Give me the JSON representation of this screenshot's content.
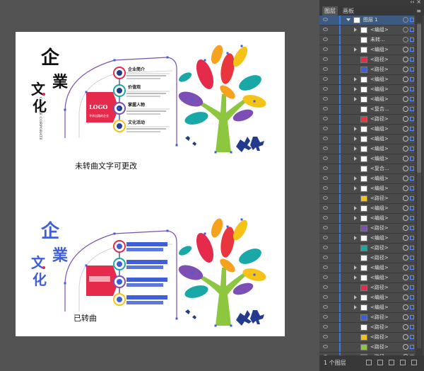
{
  "artboard": {
    "caption_top": "未转曲文字可更改",
    "caption_bottom": "已转曲",
    "title_chars": [
      "企",
      "業",
      "文",
      "化"
    ],
    "subtitle": "CULTURE CORPORATE",
    "logo_text": "LOGO",
    "logo_sub": "寻求出路的企业",
    "items": [
      "企业简介",
      "价值观",
      "掌握人物",
      "文化活动"
    ],
    "colors": {
      "accent": "#e52a4c",
      "blue": "#3f5fd8",
      "teal": "#18a8a8",
      "purple": "#7b4fb3",
      "yellow": "#f5c318",
      "green": "#8dc63f",
      "orange": "#f6a21e",
      "red": "#e8353e",
      "navy": "#243a8c"
    }
  },
  "panel": {
    "title_strip": "‹‹  ×",
    "tabs": [
      "图层",
      "画板"
    ],
    "menu_icon": "≡",
    "rows": [
      {
        "label": "图层 1",
        "level": "top",
        "arrow": true,
        "target": "ring"
      },
      {
        "label": "<编组>",
        "arrow": true,
        "target": "ring"
      },
      {
        "label": "未转...",
        "arrow": false,
        "target": "ring"
      },
      {
        "label": "<编组>",
        "arrow": true,
        "target": "filled"
      },
      {
        "label": "<路径>",
        "arrow": false,
        "target": "filled"
      },
      {
        "label": "<路径>",
        "arrow": false,
        "target": "filled"
      },
      {
        "label": "<编组>",
        "arrow": true,
        "target": "filled"
      },
      {
        "label": "<编组>",
        "arrow": true,
        "target": "filled"
      },
      {
        "label": "<编组>",
        "arrow": true,
        "target": "filled"
      },
      {
        "label": "<复合...",
        "arrow": false,
        "target": "filled"
      },
      {
        "label": "<路径>",
        "arrow": false,
        "target": "filled"
      },
      {
        "label": "<编组>",
        "arrow": true,
        "target": "filled"
      },
      {
        "label": "<编组>",
        "arrow": true,
        "target": "filled"
      },
      {
        "label": "<编组>",
        "arrow": true,
        "target": "filled"
      },
      {
        "label": "<编组>",
        "arrow": true,
        "target": "filled"
      },
      {
        "label": "<复合...",
        "arrow": false,
        "target": "filled"
      },
      {
        "label": "<编组>",
        "arrow": true,
        "target": "filled"
      },
      {
        "label": "<编组>",
        "arrow": true,
        "target": "filled"
      },
      {
        "label": "<路径>",
        "arrow": false,
        "target": "filled"
      },
      {
        "label": "<编组>",
        "arrow": true,
        "target": "filled"
      },
      {
        "label": "<编组>",
        "arrow": true,
        "target": "filled"
      },
      {
        "label": "<路径>",
        "arrow": false,
        "target": "filled"
      },
      {
        "label": "<编组>",
        "arrow": true,
        "target": "filled"
      },
      {
        "label": "<路径>",
        "arrow": false,
        "target": "filled"
      },
      {
        "label": "<路径>",
        "arrow": false,
        "target": "filled"
      },
      {
        "label": "<编组>",
        "arrow": true,
        "target": "filled"
      },
      {
        "label": "<编组>",
        "arrow": true,
        "target": "filled"
      },
      {
        "label": "<路径>",
        "arrow": false,
        "target": "filled"
      },
      {
        "label": "<编组>",
        "arrow": true,
        "target": "filled"
      },
      {
        "label": "<编组>",
        "arrow": true,
        "target": "filled"
      },
      {
        "label": "<路径>",
        "arrow": false,
        "target": "filled"
      },
      {
        "label": "<路径>",
        "arrow": false,
        "target": "filled"
      },
      {
        "label": "<路径>",
        "arrow": false,
        "target": "filled"
      },
      {
        "label": "<路径>",
        "arrow": false,
        "target": "filled"
      },
      {
        "label": "<路径>",
        "arrow": false,
        "target": "filled"
      }
    ],
    "thumb_colors": [
      "#ffffff",
      "#ffffff",
      "#ffffff",
      "#ffffff",
      "#e52a4c",
      "#3f5fd8",
      "#ffffff",
      "#ffffff",
      "#ffffff",
      "#ffffff",
      "#e8353e",
      "#ffffff",
      "#ffffff",
      "#ffffff",
      "#ffffff",
      "#ffffff",
      "#ffffff",
      "#ffffff",
      "#f5c318",
      "#ffffff",
      "#ffffff",
      "#7b4fb3",
      "#ffffff",
      "#18a8a8",
      "#ffffff",
      "#ffffff",
      "#ffffff",
      "#e52a4c",
      "#ffffff",
      "#ffffff",
      "#3f5fd8",
      "#ffffff",
      "#f5c318",
      "#8dc63f",
      "#e8353e"
    ],
    "footer": {
      "count": "1 个图层"
    }
  }
}
